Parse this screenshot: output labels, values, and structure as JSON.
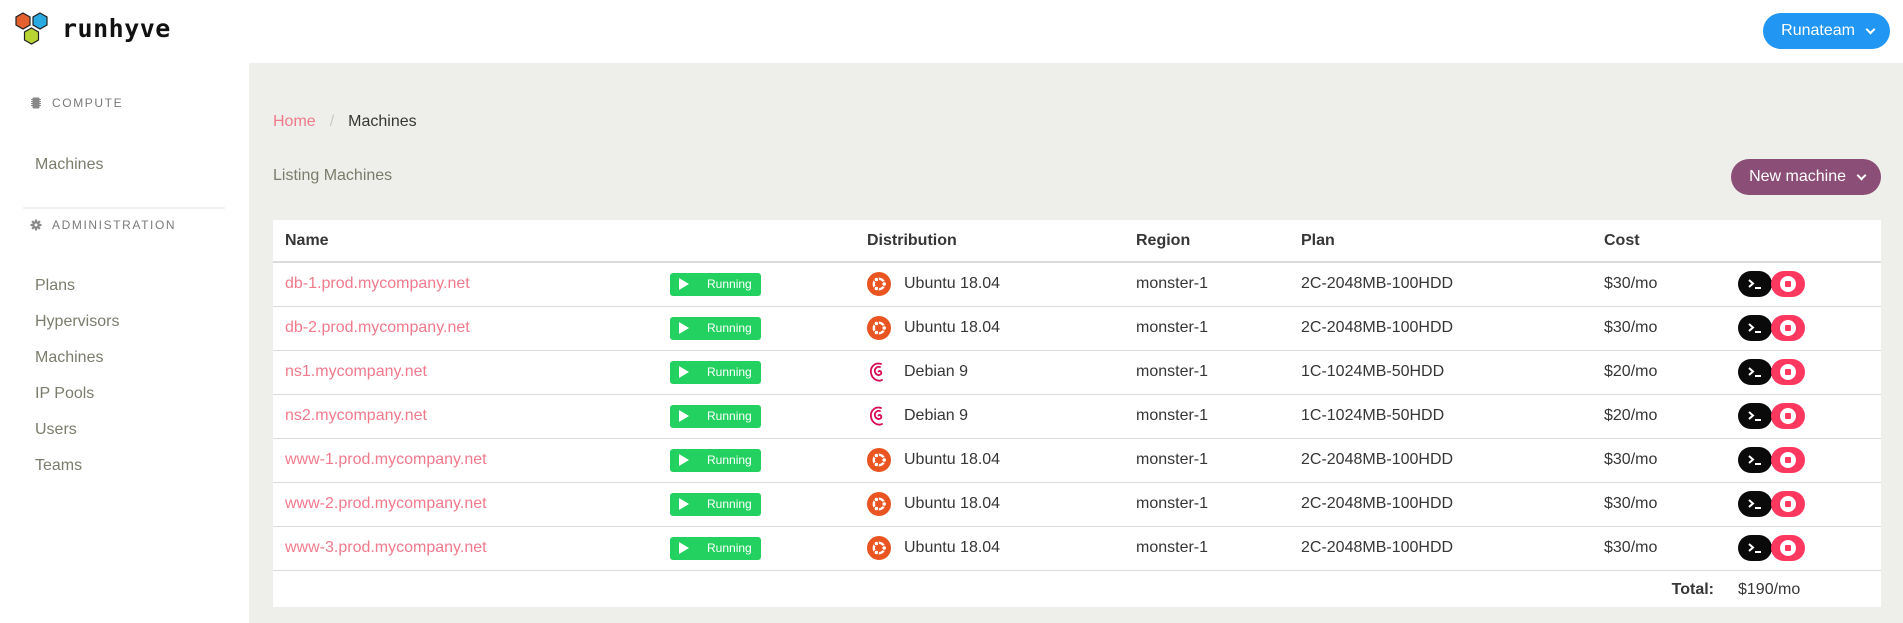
{
  "brand": {
    "name": "runhyve",
    "logo_colors": [
      "#e4612e",
      "#29aae1",
      "#b8d432"
    ]
  },
  "header": {
    "team_button": "Runateam",
    "team_button_color": "#2196f3"
  },
  "sidebar": {
    "sections": [
      {
        "label": "COMPUTE",
        "icon": "chip-icon",
        "items": [
          {
            "label": "Machines"
          }
        ]
      },
      {
        "label": "ADMINISTRATION",
        "icon": "gear-icon",
        "items": [
          {
            "label": "Plans"
          },
          {
            "label": "Hypervisors"
          },
          {
            "label": "Machines"
          },
          {
            "label": "IP Pools"
          },
          {
            "label": "Users"
          },
          {
            "label": "Teams"
          }
        ]
      }
    ]
  },
  "breadcrumb": {
    "home": "Home",
    "separator": "/",
    "current": "Machines"
  },
  "page": {
    "title": "Listing Machines",
    "new_button": "New machine",
    "new_button_color": "#8b4e76"
  },
  "table": {
    "columns": [
      "Name",
      "",
      "Distribution",
      "Region",
      "Plan",
      "Cost",
      ""
    ],
    "rows": [
      {
        "name": "db-1.prod.mycompany.net",
        "status": "Running",
        "distribution": "Ubuntu 18.04",
        "distro_icon": "ubuntu-icon",
        "region": "monster-1",
        "plan": "2C-2048MB-100HDD",
        "cost": "$30/mo"
      },
      {
        "name": "db-2.prod.mycompany.net",
        "status": "Running",
        "distribution": "Ubuntu 18.04",
        "distro_icon": "ubuntu-icon",
        "region": "monster-1",
        "plan": "2C-2048MB-100HDD",
        "cost": "$30/mo"
      },
      {
        "name": "ns1.mycompany.net",
        "status": "Running",
        "distribution": "Debian 9",
        "distro_icon": "debian-icon",
        "region": "monster-1",
        "plan": "1C-1024MB-50HDD",
        "cost": "$20/mo"
      },
      {
        "name": "ns2.mycompany.net",
        "status": "Running",
        "distribution": "Debian 9",
        "distro_icon": "debian-icon",
        "region": "monster-1",
        "plan": "1C-1024MB-50HDD",
        "cost": "$20/mo"
      },
      {
        "name": "www-1.prod.mycompany.net",
        "status": "Running",
        "distribution": "Ubuntu 18.04",
        "distro_icon": "ubuntu-icon",
        "region": "monster-1",
        "plan": "2C-2048MB-100HDD",
        "cost": "$30/mo"
      },
      {
        "name": "www-2.prod.mycompany.net",
        "status": "Running",
        "distribution": "Ubuntu 18.04",
        "distro_icon": "ubuntu-icon",
        "region": "monster-1",
        "plan": "2C-2048MB-100HDD",
        "cost": "$30/mo"
      },
      {
        "name": "www-3.prod.mycompany.net",
        "status": "Running",
        "distribution": "Ubuntu 18.04",
        "distro_icon": "ubuntu-icon",
        "region": "monster-1",
        "plan": "2C-2048MB-100HDD",
        "cost": "$30/mo"
      }
    ],
    "total_label": "Total:",
    "total_value": "$190/mo"
  },
  "colors": {
    "link": "#f07a8c",
    "running": "#23d160",
    "stop": "#ff3860",
    "console": "#0a0a0a",
    "ubuntu": "#e95420",
    "debian": "#d70a53"
  }
}
